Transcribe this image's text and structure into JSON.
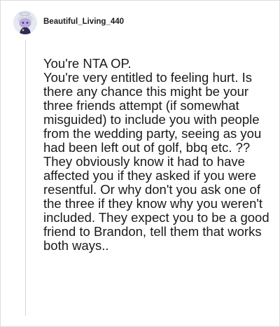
{
  "comment": {
    "username": "Beautiful_Living_440",
    "avatar_icon": "snoo-avatar-icon",
    "body": "You're NTA OP.\nYou're very entitled to feeling hurt. Is there any chance this might be your three friends attempt (if somewhat misguided) to include you with people from the wedding party, seeing as you had been left out of golf, bbq etc. ?? They obviously know it had to have affected you if they asked if you were resentful. Or why don't you ask one of the three if they know why you weren't included. They expect you to be a good friend to Brandon, tell them that works both ways.."
  }
}
